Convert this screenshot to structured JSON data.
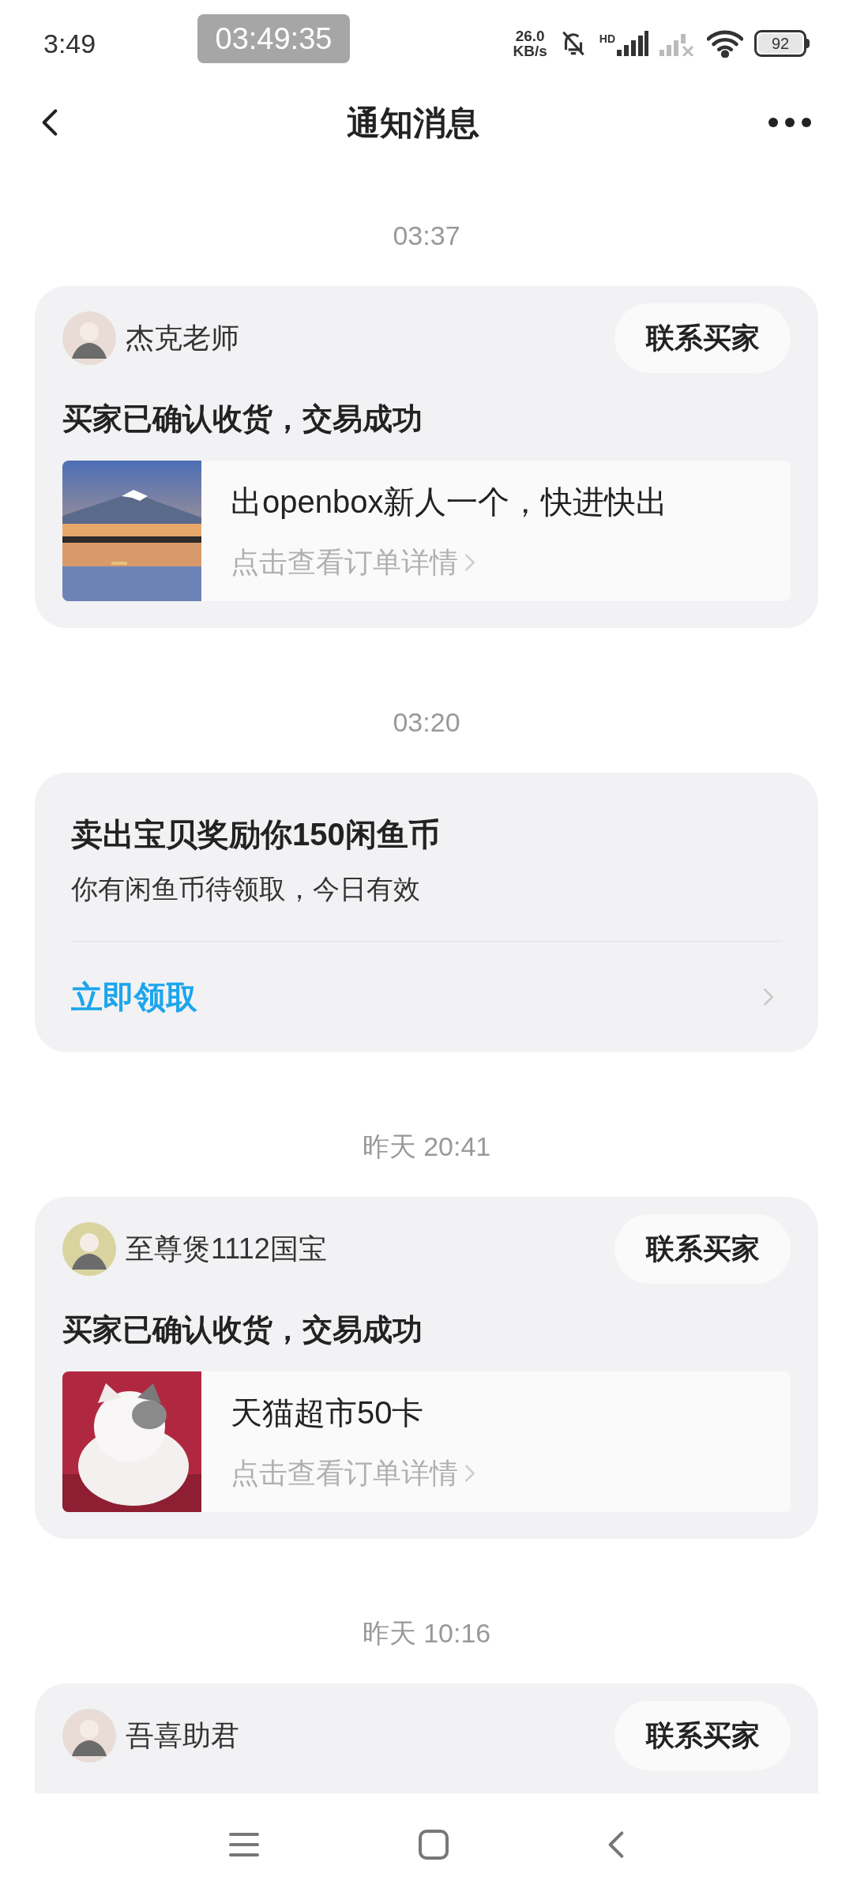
{
  "status_bar": {
    "time": "3:49",
    "recorder_time": "03:49:35",
    "net_speed": "26.0",
    "net_unit": "KB/s",
    "signal_label": "HD",
    "battery": "92"
  },
  "header": {
    "title": "通知消息"
  },
  "messages": [
    {
      "kind": "order",
      "time": "03:37",
      "user": "杰克老师",
      "button": "联系买家",
      "title": "买家已确认收货，交易成功",
      "product": "出openbox新人一个，快进快出",
      "link": "点击查看订单详情"
    },
    {
      "kind": "reward",
      "time": "03:20",
      "title": "卖出宝贝奖励你150闲鱼币",
      "subtitle": "你有闲鱼币待领取，今日有效",
      "action": "立即领取"
    },
    {
      "kind": "order",
      "time": "昨天 20:41",
      "user": "至尊煲1112国宝",
      "button": "联系买家",
      "title": "买家已确认收货，交易成功",
      "product": "天猫超市50卡",
      "link": "点击查看订单详情"
    },
    {
      "kind": "order_cut",
      "time": "昨天 10:16",
      "user": "吾喜助君",
      "button": "联系买家"
    }
  ]
}
